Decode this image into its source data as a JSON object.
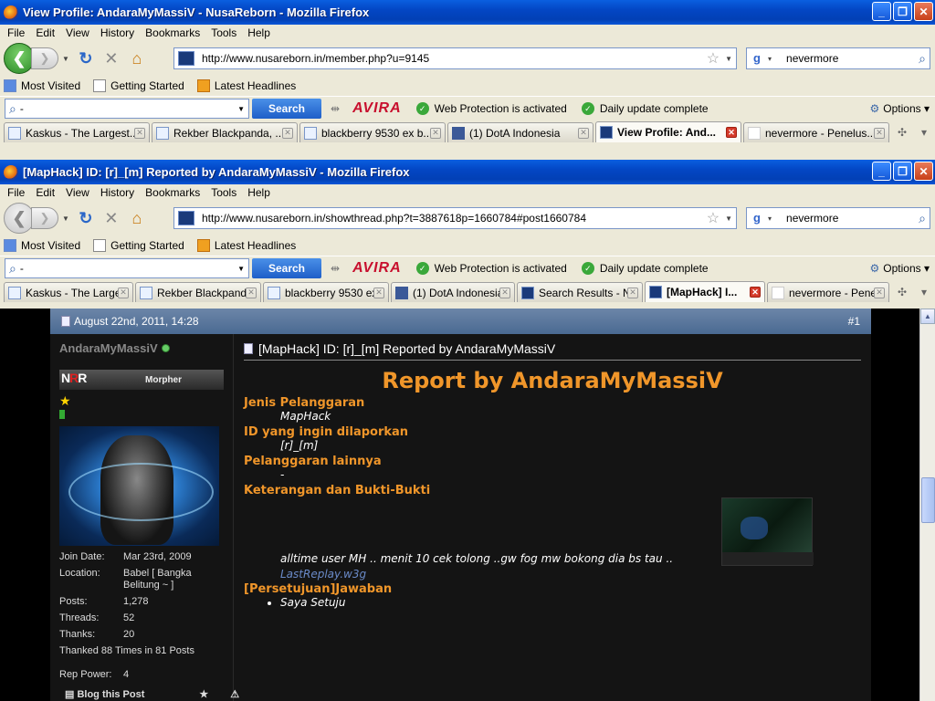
{
  "back_window": {
    "title": "View Profile: AndaraMyMassiV - NusaReborn - Mozilla Firefox",
    "url": "http://www.nusareborn.in/member.php?u=9145",
    "tabs": [
      {
        "label": "Kaskus - The Largest..."
      },
      {
        "label": "Rekber Blackpanda, ..."
      },
      {
        "label": "blackberry 9530 ex b..."
      },
      {
        "label": "(1) DotA Indonesia"
      },
      {
        "label": "View Profile: And..."
      },
      {
        "label": "nevermore - Penelus..."
      }
    ]
  },
  "front_window": {
    "title": "[MapHack] ID: [r]_[m] Reported by AndaraMyMassiV - Mozilla Firefox",
    "url": "http://www.nusareborn.in/showthread.php?t=3887618p=1660784#post1660784",
    "tabs": [
      {
        "label": "Kaskus - The Larges..."
      },
      {
        "label": "Rekber Blackpanda,..."
      },
      {
        "label": "blackberry 9530 ex ..."
      },
      {
        "label": "(1) DotA Indonesia"
      },
      {
        "label": "Search Results - Nu..."
      },
      {
        "label": "[MapHack] I..."
      },
      {
        "label": "nevermore - Penelu..."
      }
    ]
  },
  "menu": {
    "file": "File",
    "edit": "Edit",
    "view": "View",
    "history": "History",
    "bookmarks": "Bookmarks",
    "tools": "Tools",
    "help": "Help"
  },
  "search_query": "nevermore",
  "bookmarks": {
    "most_visited": "Most Visited",
    "getting_started": "Getting Started",
    "latest_headlines": "Latest Headlines"
  },
  "avira": {
    "search_value": "-",
    "search_button": "Search",
    "logo": "AVIRA",
    "web_protection": "Web Protection is activated",
    "daily_update": "Daily update complete",
    "options": "Options"
  },
  "post": {
    "date": "August 22nd, 2011, 14:28",
    "number": "#1",
    "username": "AndaraMyMassiV",
    "user_title": "Morpher",
    "stats": [
      {
        "k": "Join Date:",
        "v": "Mar 23rd, 2009"
      },
      {
        "k": "Location:",
        "v": "Babel [ Bangka Belitung ~ ]"
      },
      {
        "k": "Posts:",
        "v": "1,278"
      },
      {
        "k": "Threads:",
        "v": "52"
      },
      {
        "k": "Thanks:",
        "v": "20"
      }
    ],
    "thanked": "Thanked 88 Times in 81 Posts",
    "rep_power_label": "Rep Power:",
    "rep_power_value": "4",
    "blog": "Blog this Post",
    "title": "[MapHack] ID: [r]_[m] Reported by AndaraMyMassiV",
    "report_head": "Report by AndaraMyMassiV",
    "jenis_label": "Jenis Pelanggaran",
    "jenis_value": "MapHack",
    "id_label": "ID yang ingin dilaporkan",
    "id_value": "[r]_[m]",
    "lainnya_label": "Pelanggaran lainnya",
    "lainnya_value": "-",
    "bukti_label": "Keterangan dan Bukti-Bukti",
    "bukti_text": "alltime user MH .. menit 10 cek tolong ..gw fog mw bokong dia bs tau ..",
    "replay_link": "LastReplay.w3g",
    "jawaban_label": "[Persetujuan]Jawaban",
    "jawaban_item": "Saya Setuju"
  }
}
